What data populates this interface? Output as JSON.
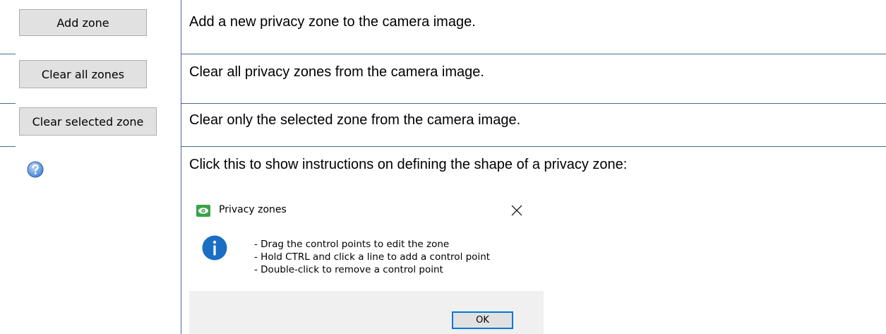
{
  "rows": [
    {
      "button_label": "Add zone",
      "description": "Add a new privacy zone to the camera image."
    },
    {
      "button_label": "Clear all zones",
      "description": "Clear all privacy zones from the camera image."
    },
    {
      "button_label": "Clear selected zone",
      "description": "Clear only the selected zone from the camera image."
    },
    {
      "icon": "help-icon",
      "description": "Click this to show instructions on defining the shape of a privacy zone:"
    }
  ],
  "dialog": {
    "title": "Privacy zones",
    "title_icon": "eye-icon",
    "close_icon": "close-icon",
    "info_icon": "info-icon",
    "lines": [
      "- Drag the control points to edit the zone",
      "- Hold CTRL and click a line to add a control point",
      "- Double-click to remove a control point"
    ],
    "ok_label": "OK"
  },
  "colors": {
    "divider": "#4a6b94",
    "button_face": "#e1e1e1",
    "info_blue": "#1a6fc4",
    "eye_green": "#3aa34a",
    "focus_border": "#0078d7"
  }
}
